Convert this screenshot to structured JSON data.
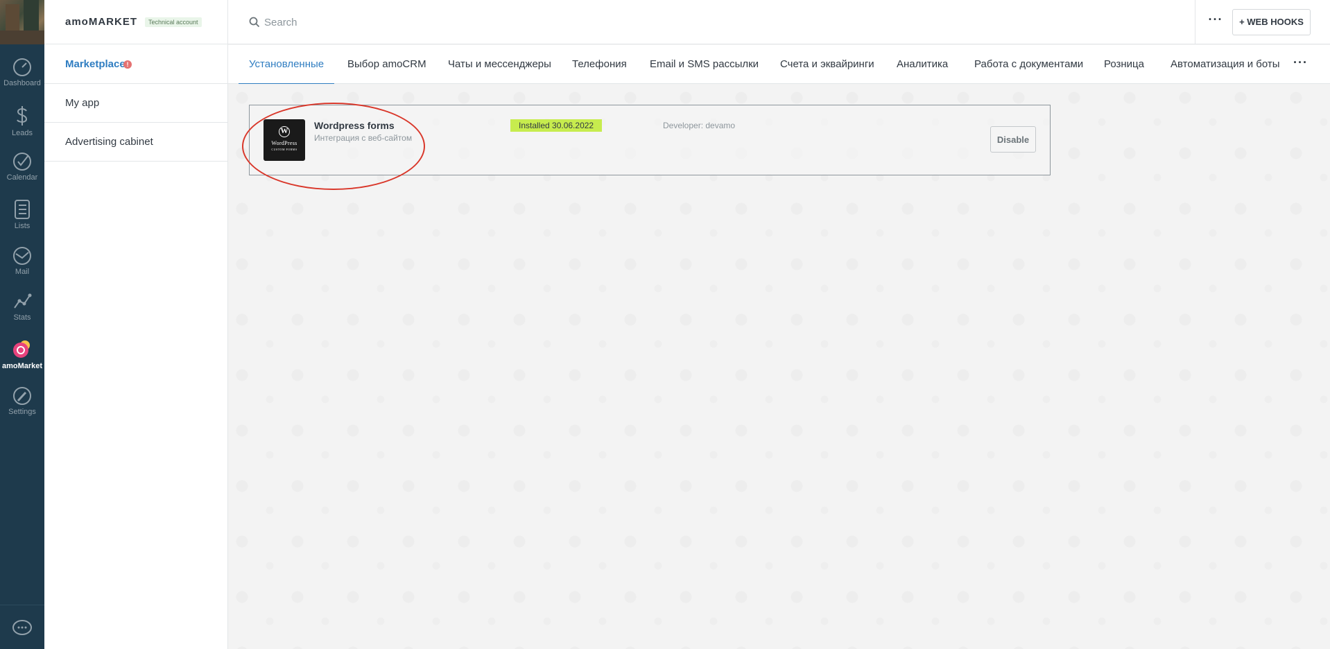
{
  "nav": {
    "items": [
      {
        "label": "Dashboard",
        "icon": "speedometer-icon"
      },
      {
        "label": "Leads",
        "icon": "dollar-icon"
      },
      {
        "label": "Calendar",
        "icon": "checkmark-icon"
      },
      {
        "label": "Lists",
        "icon": "list-icon"
      },
      {
        "label": "Mail",
        "icon": "mail-icon"
      },
      {
        "label": "Stats",
        "icon": "chart-icon"
      },
      {
        "label": "amoMarket",
        "icon": "market-icon"
      },
      {
        "label": "Settings",
        "icon": "wrench-icon"
      }
    ],
    "chat_icon": "chat-icon"
  },
  "sidebar": {
    "brand": "amoMARKET",
    "badge": "Technical account",
    "items": [
      {
        "label": "Marketplace",
        "alert": "!"
      },
      {
        "label": "My app"
      },
      {
        "label": "Advertising cabinet"
      }
    ]
  },
  "topbar": {
    "search_placeholder": "Search",
    "more_label": "···",
    "webhooks_label": "+ WEB HOOKS"
  },
  "tabs": {
    "items": [
      "Установленные",
      "Выбор amoCRM",
      "Чаты и мессенджеры",
      "Телефония",
      "Email и SMS рассылки",
      "Счета и эквайринги",
      "Аналитика",
      "Работа с документами",
      "Розница",
      "Автоматизация и боты"
    ],
    "more_label": "···"
  },
  "app_card": {
    "logo_text_top": "WordPress",
    "logo_text_bottom": "CUSTOM FORMS",
    "logo_glyph": "W",
    "name": "Wordpress forms",
    "description": "Интеграция с веб-сайтом",
    "installed": "Installed 30.06.2022",
    "developer": "Developer: devamo",
    "disable_label": "Disable"
  },
  "colors": {
    "nav_bg": "#1e3a4c",
    "accent": "#2f7dc1",
    "installed_badge": "#c7ec4e",
    "highlight": "#d9372a"
  }
}
